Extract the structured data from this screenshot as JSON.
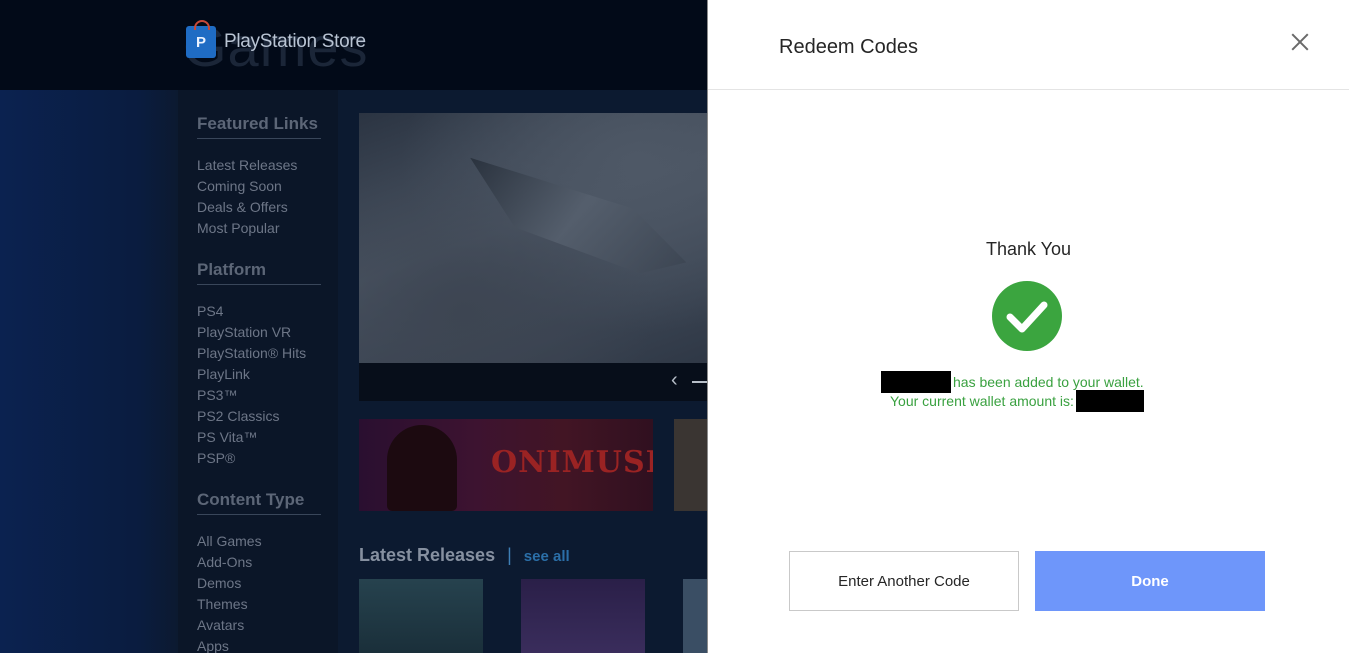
{
  "store": {
    "background_word": "Games",
    "logo": {
      "glyph": "P",
      "brand": "PlayStation Store"
    },
    "sidebar": {
      "featured": {
        "heading": "Featured Links",
        "items": [
          "Latest Releases",
          "Coming Soon",
          "Deals & Offers",
          "Most Popular"
        ]
      },
      "platform": {
        "heading": "Platform",
        "items": [
          "PS4",
          "PlayStation VR",
          "PlayStation® Hits",
          "PlayLink",
          "PS3™",
          "PS2 Classics",
          "PS Vita™",
          "PSP®"
        ]
      },
      "content_type": {
        "heading": "Content Type",
        "items": [
          "All Games",
          "Add-Ons",
          "Demos",
          "Themes",
          "Avatars",
          "Apps"
        ]
      }
    },
    "carousel": {
      "prev_icon": "‹"
    },
    "promo_tile": {
      "title": "ONIMUSHA"
    },
    "latest": {
      "heading": "Latest Releases",
      "separator": "|",
      "see_all": "see all"
    }
  },
  "modal": {
    "title": "Redeem Codes",
    "close_icon": "close-icon",
    "thank_you": "Thank You",
    "success_icon": "checkmark-icon",
    "added_text": "has been added to your wallet.",
    "wallet_text": "Your current wallet amount is:",
    "buttons": {
      "enter_another": "Enter Another Code",
      "done": "Done"
    }
  },
  "colors": {
    "success_green": "#3aa140",
    "primary_button": "#6e96fa",
    "store_background": "#0c1a30"
  }
}
